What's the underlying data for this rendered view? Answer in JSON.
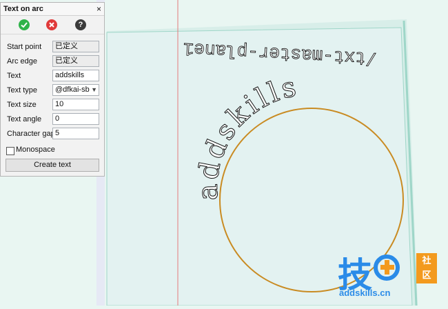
{
  "panel": {
    "title": "Text on arc",
    "close_symbol": "×",
    "actions": [
      {
        "name": "confirm",
        "icon": "check-icon",
        "color": "#2fb34a"
      },
      {
        "name": "cancel",
        "icon": "close-icon",
        "color": "#e03a3a"
      },
      {
        "name": "help",
        "icon": "help-icon",
        "symbol": "?"
      }
    ],
    "fields": {
      "start_point": {
        "label": "Start point",
        "value": "已定义"
      },
      "arc_edge": {
        "label": "Arc edge",
        "value": "已定义"
      },
      "text": {
        "label": "Text",
        "value": "addskills"
      },
      "text_type": {
        "label": "Text type",
        "value": "@dfkai-sb"
      },
      "text_size": {
        "label": "Text size",
        "value": "10"
      },
      "text_angle": {
        "label": "Text angle",
        "value": "0"
      },
      "character_gap": {
        "label": "Character gap",
        "value": "5"
      }
    },
    "monospace": {
      "label": "Monospace",
      "checked": false
    },
    "create_button": "Create text"
  },
  "canvas": {
    "plane_label": "/txt-master-plane1",
    "arc_text": "addskills",
    "colors": {
      "plane_fill": "#e3f2f1",
      "plane_edge": "#9ed6c8",
      "circle": "#c98b22",
      "vertical_line": "#e47a7a"
    }
  },
  "watermark": {
    "main_glyph": "技",
    "badge_top": "社",
    "badge_bottom": "区",
    "site": "addskills.cn",
    "colors": {
      "blue": "#2a8be8",
      "orange": "#f39a1e"
    }
  }
}
